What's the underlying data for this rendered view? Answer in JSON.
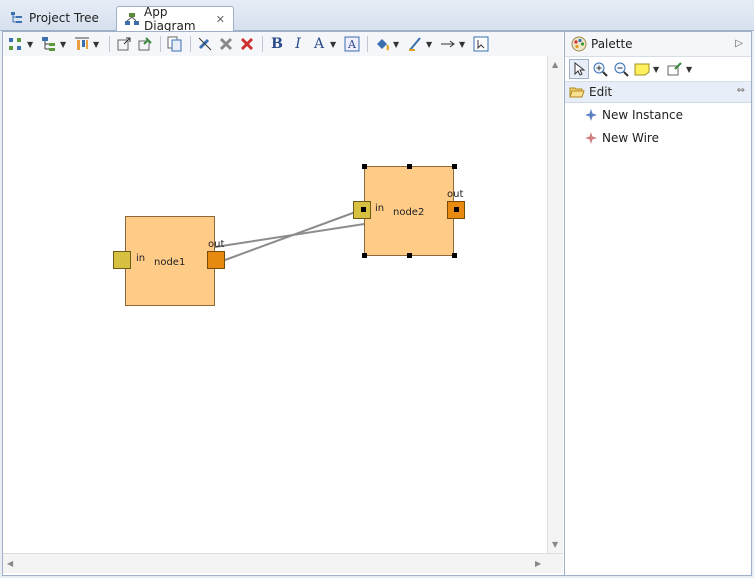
{
  "tabs": [
    {
      "label": "Project Tree",
      "icon": "tree-icon",
      "active": false
    },
    {
      "label": "App Diagram",
      "icon": "diagram-icon",
      "active": true
    }
  ],
  "palette": {
    "title": "Palette",
    "drawer": "Edit",
    "entries": [
      {
        "label": "New Instance",
        "icon": "instance-icon"
      },
      {
        "label": "New Wire",
        "icon": "wire-icon"
      }
    ]
  },
  "diagram": {
    "nodes": [
      {
        "name": "node1",
        "in_label": "in",
        "out_label": "out"
      },
      {
        "name": "node2",
        "in_label": "in",
        "out_label": "out",
        "selected": true
      }
    ]
  },
  "colors": {
    "node_fill": "#ffcc88",
    "in_port": "#d8c040",
    "out_port": "#e88a10",
    "wire": "#8c8c8c"
  }
}
